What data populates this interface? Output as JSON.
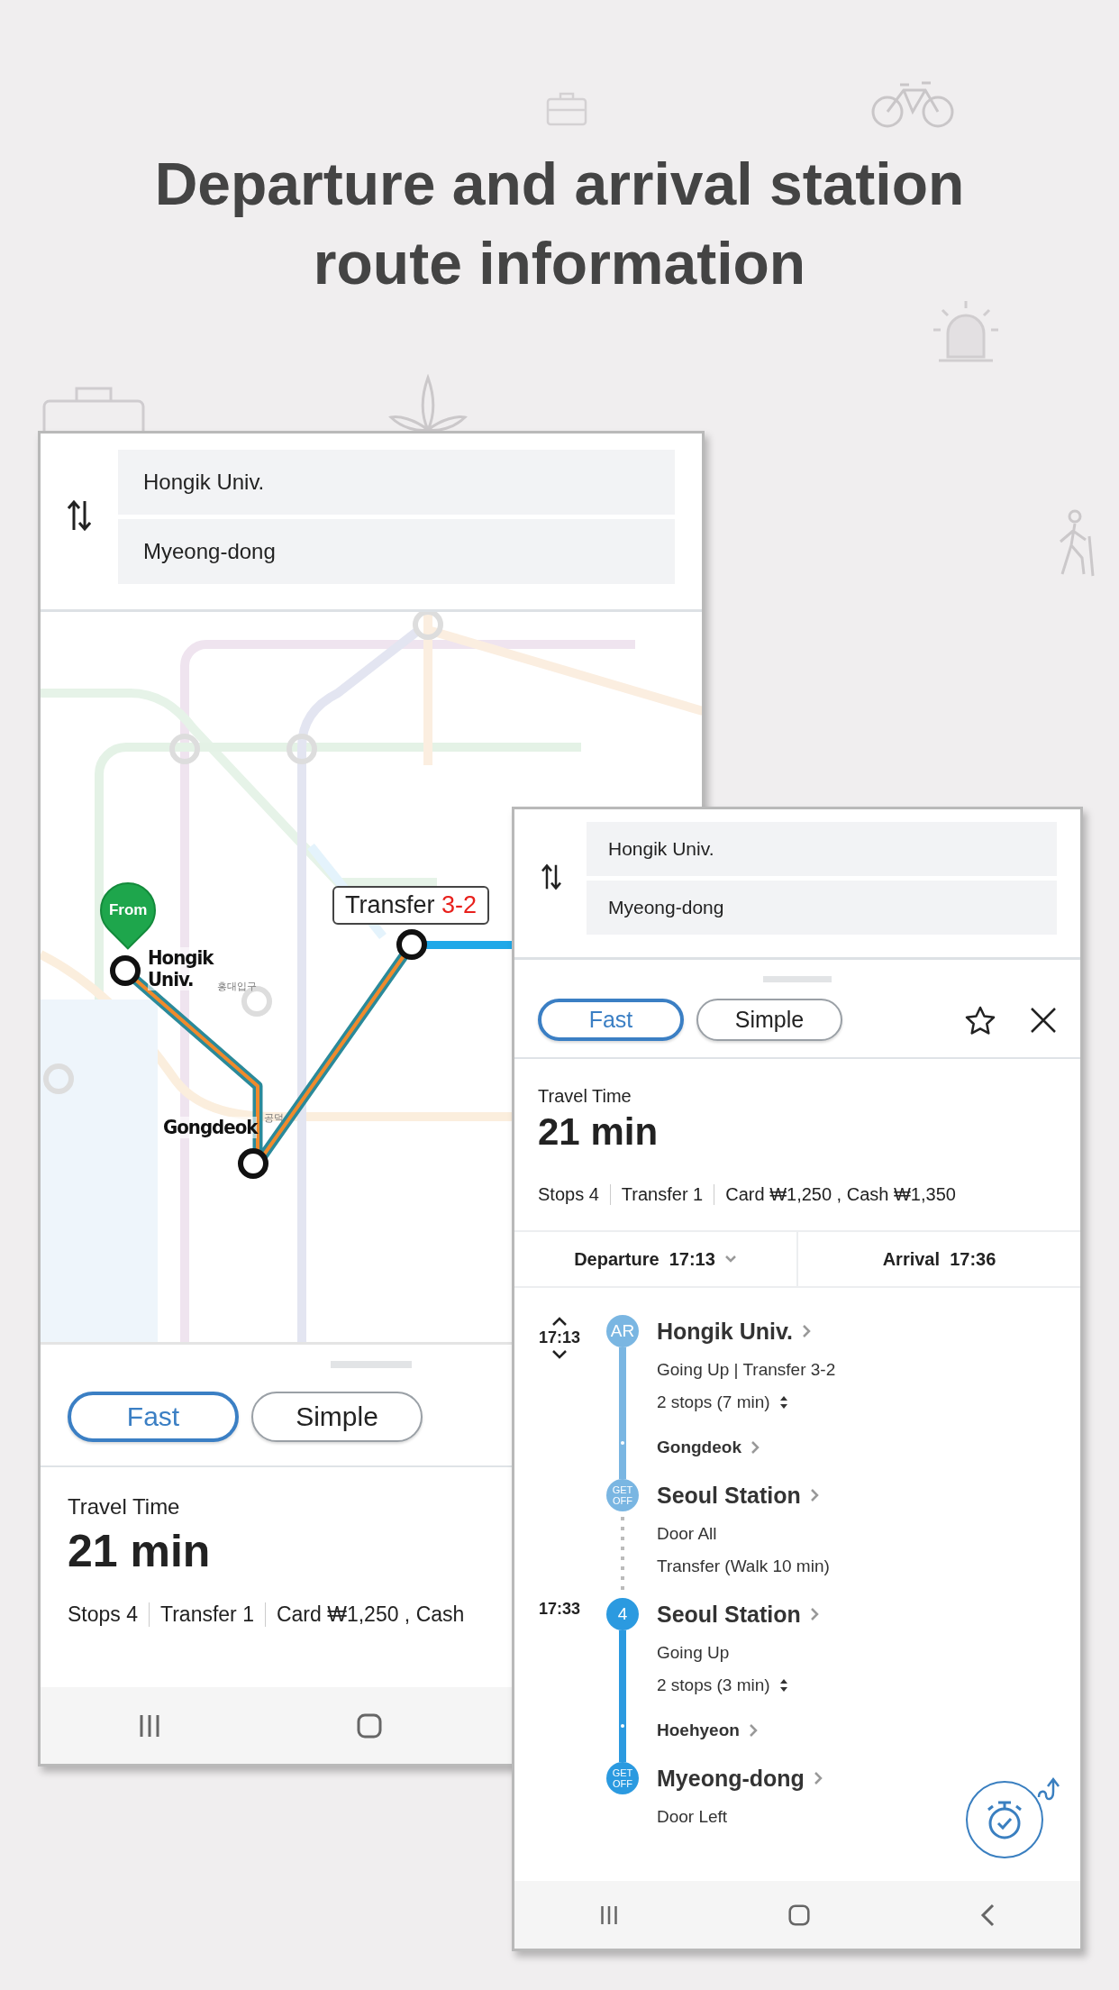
{
  "headline": "Departure and arrival station route information",
  "map_screen": {
    "origin": "Hongik Univ.",
    "destination": "Myeong-dong",
    "map": {
      "pin_label": "From",
      "start_station": "Hongik Univ.",
      "start_station_local": "홍대입구",
      "via_station": "Gongdeok",
      "via_station_local": "공덕",
      "callout_label": "Transfer",
      "callout_code": "3-2"
    },
    "route_tabs": [
      {
        "label": "Fast",
        "selected": true
      },
      {
        "label": "Simple",
        "selected": false
      }
    ],
    "travel_time_label": "Travel Time",
    "travel_time": "21 min",
    "stats": [
      "Stops 4",
      "Transfer 1",
      "Card ₩1,250 , Cash"
    ]
  },
  "detail_screen": {
    "origin": "Hongik Univ.",
    "destination": "Myeong-dong",
    "route_tabs": [
      {
        "label": "Fast",
        "selected": true
      },
      {
        "label": "Simple",
        "selected": false
      }
    ],
    "travel_time_label": "Travel Time",
    "travel_time": "21 min",
    "stats": [
      "Stops 4",
      "Transfer 1",
      "Card ₩1,250 , Cash ₩1,350"
    ],
    "departure": {
      "label": "Departure",
      "time": "17:13"
    },
    "arrival": {
      "label": "Arrival",
      "time": "17:36"
    },
    "legs": [
      {
        "time": "17:13",
        "adjustable": true,
        "badge": "AR",
        "color": "#7ab6e2",
        "station": "Hongik Univ.",
        "details": [
          "Going Up | Transfer 3-2"
        ],
        "stops": "2 stops (7 min)",
        "via": "Gongdeok",
        "end_badge": "GET OFF",
        "end_station": "Seoul Station",
        "end_details": [
          "Door All"
        ],
        "transfer_note": "Transfer (Walk 10 min)"
      },
      {
        "time": "17:33",
        "adjustable": false,
        "badge": "4",
        "color": "#2b9ae0",
        "station": "Seoul Station",
        "details": [
          "Going Up"
        ],
        "stops": "2 stops (3 min)",
        "via": "Hoehyeon",
        "end_badge": "GET OFF",
        "end_station": "Myeong-dong",
        "end_details": [
          "Door Left"
        ]
      }
    ]
  }
}
